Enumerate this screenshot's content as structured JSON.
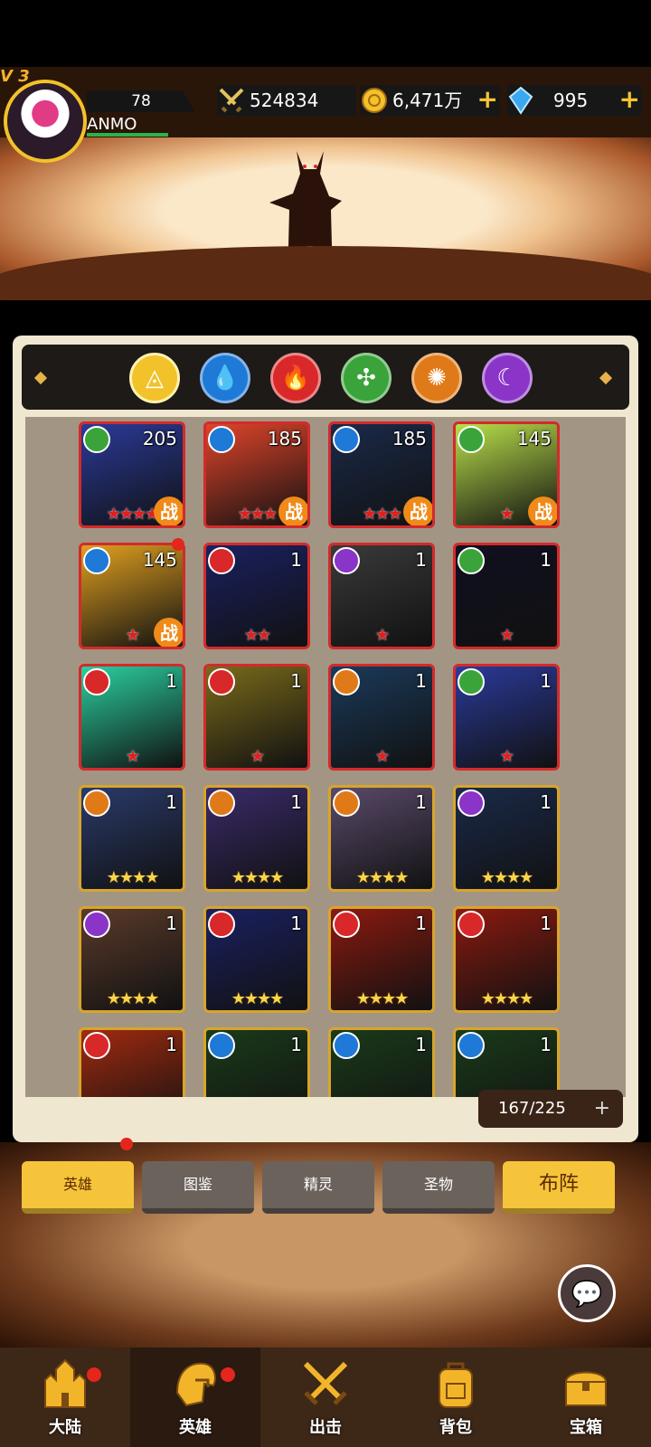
{
  "header": {
    "vip": "V 3",
    "level": "78",
    "player_name": "ANMO",
    "power": "524834",
    "gold": "6,471万",
    "gems": "995"
  },
  "elements": [
    {
      "name": "all",
      "color": "#f2c22a",
      "glyph": "◬"
    },
    {
      "name": "water",
      "color": "#1f79d6",
      "glyph": "💧"
    },
    {
      "name": "fire",
      "color": "#d8282a",
      "glyph": "🔥"
    },
    {
      "name": "wind",
      "color": "#3aa33a",
      "glyph": "✣"
    },
    {
      "name": "earth",
      "color": "#e07a18",
      "glyph": "✺"
    },
    {
      "name": "dark",
      "color": "#8b34c8",
      "glyph": "☾"
    }
  ],
  "heroes": [
    {
      "element": "wind",
      "level": "205",
      "stars": "★★★★",
      "star_color": "red",
      "frame": "red",
      "battle": "战",
      "art": "#2a3a9a"
    },
    {
      "element": "water",
      "level": "185",
      "stars": "★★★",
      "star_color": "red",
      "frame": "red",
      "battle": "战",
      "art": "#e0442a"
    },
    {
      "element": "water",
      "level": "185",
      "stars": "★★★",
      "star_color": "red",
      "frame": "red",
      "battle": "战",
      "art": "#1a2a4a"
    },
    {
      "element": "wind",
      "level": "145",
      "stars": "★",
      "star_color": "red",
      "frame": "red",
      "battle": "战",
      "art": "#b9e04a"
    },
    {
      "element": "water",
      "level": "145",
      "stars": "★",
      "star_color": "red",
      "frame": "red",
      "battle": "战",
      "art": "#e0a020"
    },
    {
      "element": "fire",
      "level": "1",
      "stars": "★★",
      "star_color": "red",
      "frame": "red",
      "battle": "",
      "art": "#1a2060"
    },
    {
      "element": "dark",
      "level": "1",
      "stars": "★",
      "star_color": "red",
      "frame": "red",
      "battle": "",
      "art": "#3a3a3a"
    },
    {
      "element": "wind",
      "level": "1",
      "stars": "★",
      "star_color": "red",
      "frame": "red",
      "battle": "",
      "art": "#101020"
    },
    {
      "element": "fire",
      "level": "1",
      "stars": "★",
      "star_color": "red",
      "frame": "red",
      "battle": "",
      "art": "#2ad0a0"
    },
    {
      "element": "fire",
      "level": "1",
      "stars": "★",
      "star_color": "red",
      "frame": "red",
      "battle": "",
      "art": "#7a6a1a"
    },
    {
      "element": "earth",
      "level": "1",
      "stars": "★",
      "star_color": "red",
      "frame": "red",
      "battle": "",
      "art": "#1a3a5a"
    },
    {
      "element": "wind",
      "level": "1",
      "stars": "★",
      "star_color": "red",
      "frame": "red",
      "battle": "",
      "art": "#2a3a9a"
    },
    {
      "element": "earth",
      "level": "1",
      "stars": "★★★★",
      "star_color": "gold",
      "frame": "gold",
      "battle": "",
      "art": "#2a3a6a"
    },
    {
      "element": "earth",
      "level": "1",
      "stars": "★★★★",
      "star_color": "gold",
      "frame": "gold",
      "battle": "",
      "art": "#3a2a6a"
    },
    {
      "element": "earth",
      "level": "1",
      "stars": "★★★★",
      "star_color": "gold",
      "frame": "gold",
      "battle": "",
      "art": "#5a4a6a"
    },
    {
      "element": "dark",
      "level": "1",
      "stars": "★★★★",
      "star_color": "gold",
      "frame": "gold",
      "battle": "",
      "art": "#1a2a4a"
    },
    {
      "element": "dark",
      "level": "1",
      "stars": "★★★★",
      "star_color": "gold",
      "frame": "gold",
      "battle": "",
      "art": "#5a3a2a"
    },
    {
      "element": "fire",
      "level": "1",
      "stars": "★★★★",
      "star_color": "gold",
      "frame": "gold",
      "battle": "",
      "art": "#1a2060"
    },
    {
      "element": "fire",
      "level": "1",
      "stars": "★★★★",
      "star_color": "gold",
      "frame": "gold",
      "battle": "",
      "art": "#8a1a10"
    },
    {
      "element": "fire",
      "level": "1",
      "stars": "★★★★",
      "star_color": "gold",
      "frame": "gold",
      "battle": "",
      "art": "#8a1a10"
    },
    {
      "element": "fire",
      "level": "1",
      "stars": "",
      "star_color": "gold",
      "frame": "gold",
      "battle": "",
      "art": "#a02a10"
    },
    {
      "element": "water",
      "level": "1",
      "stars": "",
      "star_color": "gold",
      "frame": "gold",
      "battle": "",
      "art": "#1a3a1a"
    },
    {
      "element": "water",
      "level": "1",
      "stars": "",
      "star_color": "gold",
      "frame": "gold",
      "battle": "",
      "art": "#1a3a1a"
    },
    {
      "element": "water",
      "level": "1",
      "stars": "",
      "star_color": "gold",
      "frame": "gold",
      "battle": "",
      "art": "#1a3a1a"
    }
  ],
  "hero_count": "167/225",
  "tabs": [
    "英雄",
    "图鉴",
    "精灵",
    "圣物",
    "布阵"
  ],
  "nav": [
    "大陆",
    "英雄",
    "出击",
    "背包",
    "宝箱"
  ],
  "colors": {
    "gold_accent": "#f5c431",
    "panel": "#efe7cf",
    "grid_bg": "#a39584",
    "nav_bg": "#3d2717",
    "red_dot": "#e4261c"
  }
}
